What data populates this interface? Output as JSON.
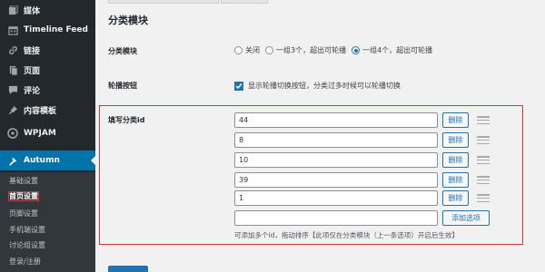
{
  "sidebar": {
    "items": [
      {
        "label": "媒体",
        "icon": "media-icon"
      },
      {
        "label": "Timeline Feed",
        "icon": "calendar-icon"
      },
      {
        "label": "链接",
        "icon": "link-icon"
      },
      {
        "label": "页面",
        "icon": "page-icon"
      },
      {
        "label": "评论",
        "icon": "comment-icon"
      },
      {
        "label": "内容模板",
        "icon": "pin-icon"
      },
      {
        "label": "WPJAM",
        "icon": "wpjam-icon"
      },
      {
        "label": "Autumn",
        "icon": "hammer-icon"
      }
    ],
    "submenu": [
      {
        "label": "基础设置"
      },
      {
        "label": "首页设置"
      },
      {
        "label": "页脚设置"
      },
      {
        "label": "手机端设置"
      },
      {
        "label": "讨论组设置"
      },
      {
        "label": "登录/注册"
      }
    ]
  },
  "main": {
    "section_title": "分类模块",
    "category_module": {
      "label": "分类模块",
      "options": [
        "关闭",
        "一组3个，超出可轮播",
        "一组4个，超出可轮播"
      ],
      "selected_index": 2
    },
    "carousel_button": {
      "label": "轮播按钮",
      "checked": true,
      "text": "显示轮播切换按钮，分类过多时候可以轮播切换"
    },
    "category_ids": {
      "label": "填写分类id",
      "values": [
        "44",
        "8",
        "10",
        "39",
        "1",
        ""
      ],
      "delete_label": "删除",
      "add_label": "添加选项",
      "hint": "可添加多个id，拖动排序【此项仅在分类模块（上一条选项）开启后生效】"
    }
  },
  "colors": {
    "sidebar_bg": "#23282d",
    "active_bg": "#0073aa",
    "accent": "#2271b1",
    "highlight_border": "#d63638"
  }
}
